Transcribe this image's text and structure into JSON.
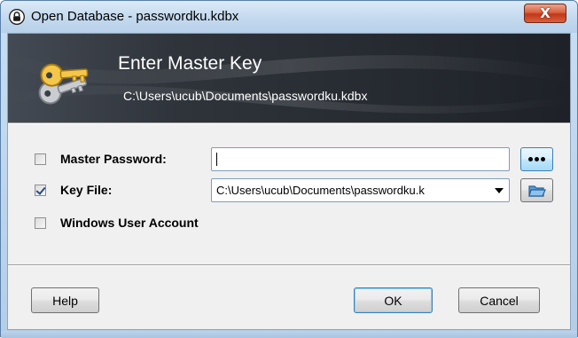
{
  "window": {
    "title": "Open Database - passwordku.kdbx",
    "close_label": "X"
  },
  "banner": {
    "title": "Enter Master Key",
    "path": "C:\\Users\\ucub\\Documents\\passwordku.kdbx"
  },
  "fields": {
    "master_password": {
      "label": "Master Password:",
      "checked": false,
      "value": ""
    },
    "key_file": {
      "label": "Key File:",
      "checked": true,
      "value": "C:\\Users\\ucub\\Documents\\passwordku.k"
    },
    "windows_user_account": {
      "label": "Windows User Account",
      "checked": false
    }
  },
  "buttons": {
    "help": "Help",
    "ok": "OK",
    "cancel": "Cancel"
  },
  "icons": {
    "title": "lock-icon",
    "banner": "keys-icon",
    "show_password": "dots-icon",
    "browse_key_file": "folder-open-icon",
    "combo_dropdown": "chevron-down-icon"
  },
  "colors": {
    "banner_dark": "#1e2228",
    "banner_text": "#ffffff",
    "close_button": "#c0381c",
    "accent_border": "#3c7fb1"
  }
}
